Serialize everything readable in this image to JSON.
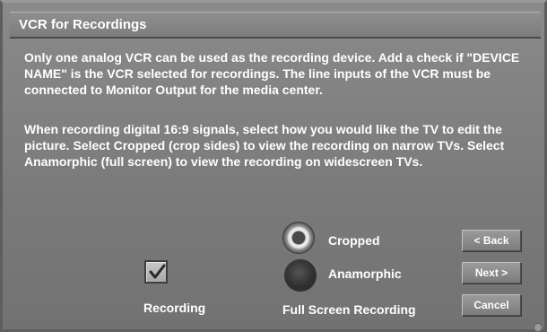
{
  "window": {
    "title": "VCR for Recordings"
  },
  "description": {
    "paragraph1": "Only one analog VCR can be used as the recording device.  Add a check if \"DEVICE NAME\" is the VCR selected for recordings.  The line inputs of the VCR must be connected to Monitor Output for the media center.",
    "paragraph2": "When recording digital 16:9 signals, select how you would like the TV to edit the picture.  Select Cropped (crop sides) to view the recording on narrow TVs.  Select Anamorphic (full screen) to view the recording on widescreen TVs."
  },
  "recording": {
    "label": "Recording",
    "checked": true
  },
  "full_screen_recording": {
    "label": "Full Screen Recording",
    "options": [
      {
        "label": "Cropped",
        "selected": true
      },
      {
        "label": "Anamorphic",
        "selected": false
      }
    ]
  },
  "buttons": {
    "back": "< Back",
    "next": "Next >",
    "cancel": "Cancel"
  }
}
